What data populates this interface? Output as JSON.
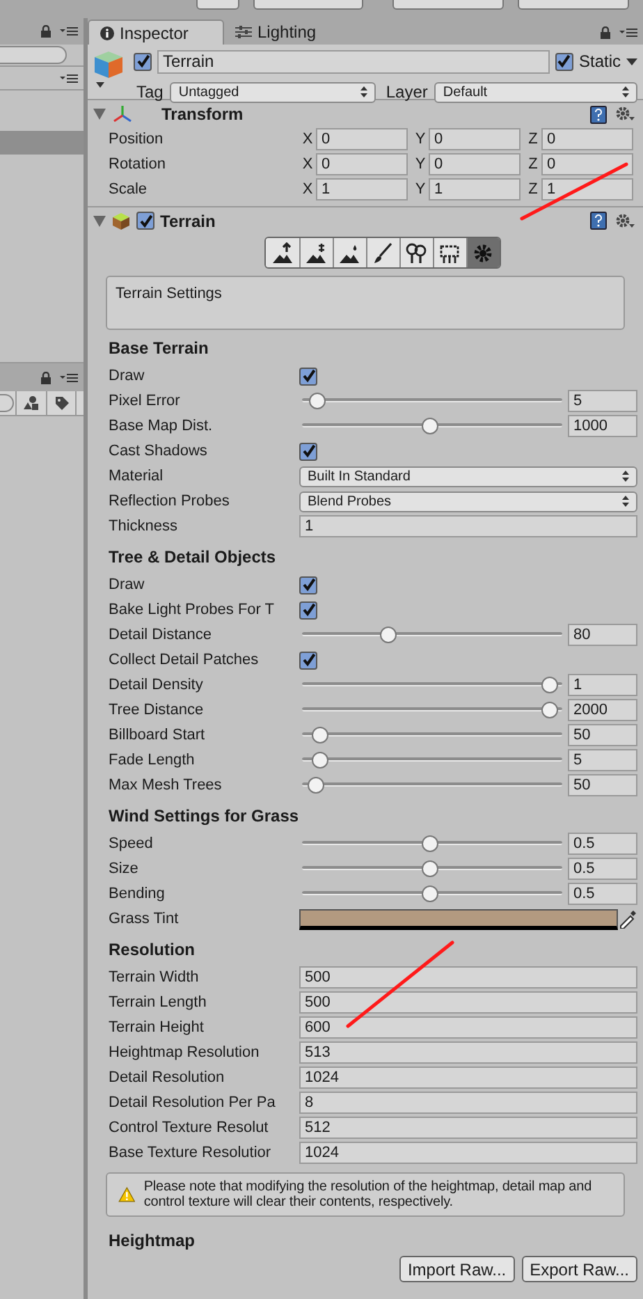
{
  "inspector_tabs": [
    {
      "label": "Inspector",
      "selected": true
    },
    {
      "label": "Lighting",
      "selected": false
    }
  ],
  "object": {
    "active": true,
    "name": "Terrain",
    "static_label": "Static",
    "static": true,
    "tag_label": "Tag",
    "tag": "Untagged",
    "layer_label": "Layer",
    "layer": "Default"
  },
  "transform": {
    "title": "Transform",
    "expanded": true,
    "rows": [
      {
        "label": "Position",
        "fields": [
          {
            "axis": "X",
            "value": "0"
          },
          {
            "axis": "Y",
            "value": "0"
          },
          {
            "axis": "Z",
            "value": "0"
          }
        ]
      },
      {
        "label": "Rotation",
        "fields": [
          {
            "axis": "X",
            "value": "0"
          },
          {
            "axis": "Y",
            "value": "0"
          },
          {
            "axis": "Z",
            "value": "0"
          }
        ]
      },
      {
        "label": "Scale",
        "fields": [
          {
            "axis": "X",
            "value": "1"
          },
          {
            "axis": "Y",
            "value": "1"
          },
          {
            "axis": "Z",
            "value": "1"
          }
        ]
      }
    ]
  },
  "terrain": {
    "title": "Terrain",
    "expanded": true,
    "enabled": true,
    "tools": [
      {
        "selected": false
      },
      {
        "selected": false
      },
      {
        "selected": false
      },
      {
        "selected": false
      },
      {
        "selected": false
      },
      {
        "selected": false
      },
      {
        "selected": true
      }
    ],
    "tool_description": "Terrain Settings",
    "sections": [
      {
        "title": "Base Terrain",
        "rows": [
          {
            "kind": "checkbox",
            "label": "Draw",
            "checked": true
          },
          {
            "kind": "slider",
            "label": "Pixel Error",
            "level": 0.03,
            "value": "5"
          },
          {
            "kind": "slider",
            "label": "Base Map Dist.",
            "level": 0.49,
            "value": "1000"
          },
          {
            "kind": "checkbox",
            "label": "Cast Shadows",
            "checked": true
          },
          {
            "kind": "dropdown",
            "label": "Material",
            "value": "Built In Standard"
          },
          {
            "kind": "dropdown",
            "label": "Reflection Probes",
            "value": "Blend Probes"
          },
          {
            "kind": "field",
            "label": "Thickness",
            "value": "1"
          }
        ]
      },
      {
        "title": "Tree & Detail Objects",
        "rows": [
          {
            "kind": "checkbox",
            "label": "Draw",
            "checked": true
          },
          {
            "kind": "checkbox",
            "label": "Bake Light Probes For T",
            "checked": true
          },
          {
            "kind": "slider",
            "label": "Detail Distance",
            "level": 0.32,
            "value": "80"
          },
          {
            "kind": "checkbox",
            "label": "Collect Detail Patches",
            "checked": true
          },
          {
            "kind": "slider",
            "label": "Detail Density",
            "level": 0.98,
            "value": "1"
          },
          {
            "kind": "slider",
            "label": "Tree Distance",
            "level": 0.98,
            "value": "2000"
          },
          {
            "kind": "slider",
            "label": "Billboard Start",
            "level": 0.04,
            "value": "50"
          },
          {
            "kind": "slider",
            "label": "Fade Length",
            "level": 0.04,
            "value": "5"
          },
          {
            "kind": "slider",
            "label": "Max Mesh Trees",
            "level": 0.02,
            "value": "50"
          }
        ]
      },
      {
        "title": "Wind Settings for Grass",
        "rows": [
          {
            "kind": "slider",
            "label": "Speed",
            "level": 0.49,
            "value": "0.5"
          },
          {
            "kind": "slider",
            "label": "Size",
            "level": 0.49,
            "value": "0.5"
          },
          {
            "kind": "slider",
            "label": "Bending",
            "level": 0.49,
            "value": "0.5"
          },
          {
            "kind": "color",
            "label": "Grass Tint",
            "color": "#b39a80"
          }
        ]
      },
      {
        "title": "Resolution",
        "rows": [
          {
            "kind": "field",
            "label": "Terrain Width",
            "value": "500"
          },
          {
            "kind": "field",
            "label": "Terrain Length",
            "value": "500"
          },
          {
            "kind": "field",
            "label": "Terrain Height",
            "value": "600"
          },
          {
            "kind": "field",
            "label": "Heightmap Resolution",
            "value": "513"
          },
          {
            "kind": "field",
            "label": "Detail Resolution",
            "value": "1024"
          },
          {
            "kind": "field",
            "label": "Detail Resolution Per Pa",
            "value": "8"
          },
          {
            "kind": "field",
            "label": "Control Texture Resolut",
            "value": "512"
          },
          {
            "kind": "field",
            "label": "Base Texture Resolutior",
            "value": "1024"
          }
        ]
      }
    ],
    "warning": "Please note that modifying the resolution of the heightmap, detail map and control texture will clear their contents, respectively.",
    "heightmap": {
      "title": "Heightmap",
      "buttons": [
        "Import Raw...",
        "Export Raw..."
      ]
    }
  }
}
